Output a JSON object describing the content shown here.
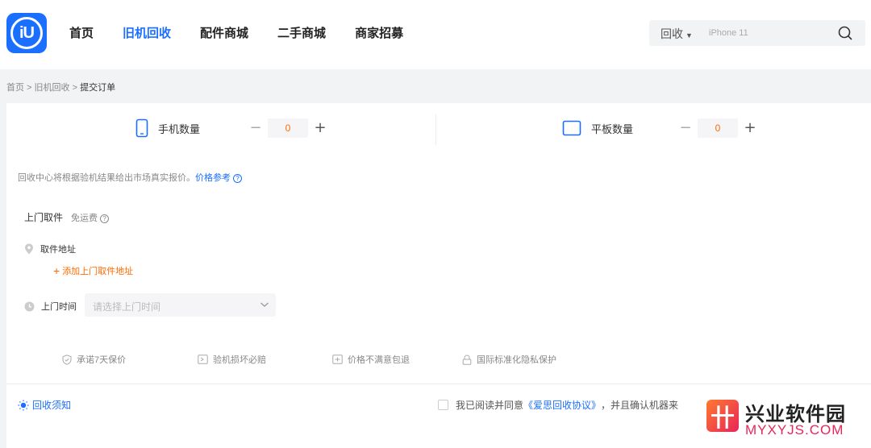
{
  "header": {
    "logo_text": "iU",
    "nav": [
      {
        "label": "首页",
        "active": false
      },
      {
        "label": "旧机回收",
        "active": true
      },
      {
        "label": "配件商城",
        "active": false
      },
      {
        "label": "二手商城",
        "active": false
      },
      {
        "label": "商家招募",
        "active": false
      }
    ],
    "search": {
      "type_label": "回收",
      "placeholder": "iPhone 11"
    }
  },
  "breadcrumb": {
    "items": [
      "首页",
      "旧机回收"
    ],
    "separator": " > ",
    "current": "提交订单"
  },
  "counters": {
    "phone": {
      "label": "手机数量",
      "value": "0"
    },
    "tablet": {
      "label": "平板数量",
      "value": "0"
    }
  },
  "notice": {
    "text": "回收中心将根据验机结果给出市场真实报价。",
    "link": "价格参考"
  },
  "pickup": {
    "title": "上门取件",
    "sub": "免运费",
    "address_label": "取件地址",
    "add_address": "添加上门取件地址",
    "time_label": "上门时间",
    "time_placeholder": "请选择上门时间"
  },
  "promises": [
    {
      "icon": "shield-icon",
      "label": "承诺7天保价"
    },
    {
      "icon": "inspect-icon",
      "label": "验机损坏必赔"
    },
    {
      "icon": "refund-icon",
      "label": "价格不满意包退"
    },
    {
      "icon": "lock-icon",
      "label": "国际标准化隐私保护"
    }
  ],
  "footer": {
    "notice_link": "回收须知",
    "agree_prefix": "我已阅读并同意",
    "agree_protocol": "《爱思回收协议》",
    "agree_suffix": "，并且确认机器来"
  },
  "watermark": {
    "logo": "卄",
    "title": "兴业软件园",
    "url": "MYXYJS.COM"
  },
  "colors": {
    "primary": "#1a6fff",
    "accent": "#ff6a00",
    "background": "#f2f3f5"
  }
}
